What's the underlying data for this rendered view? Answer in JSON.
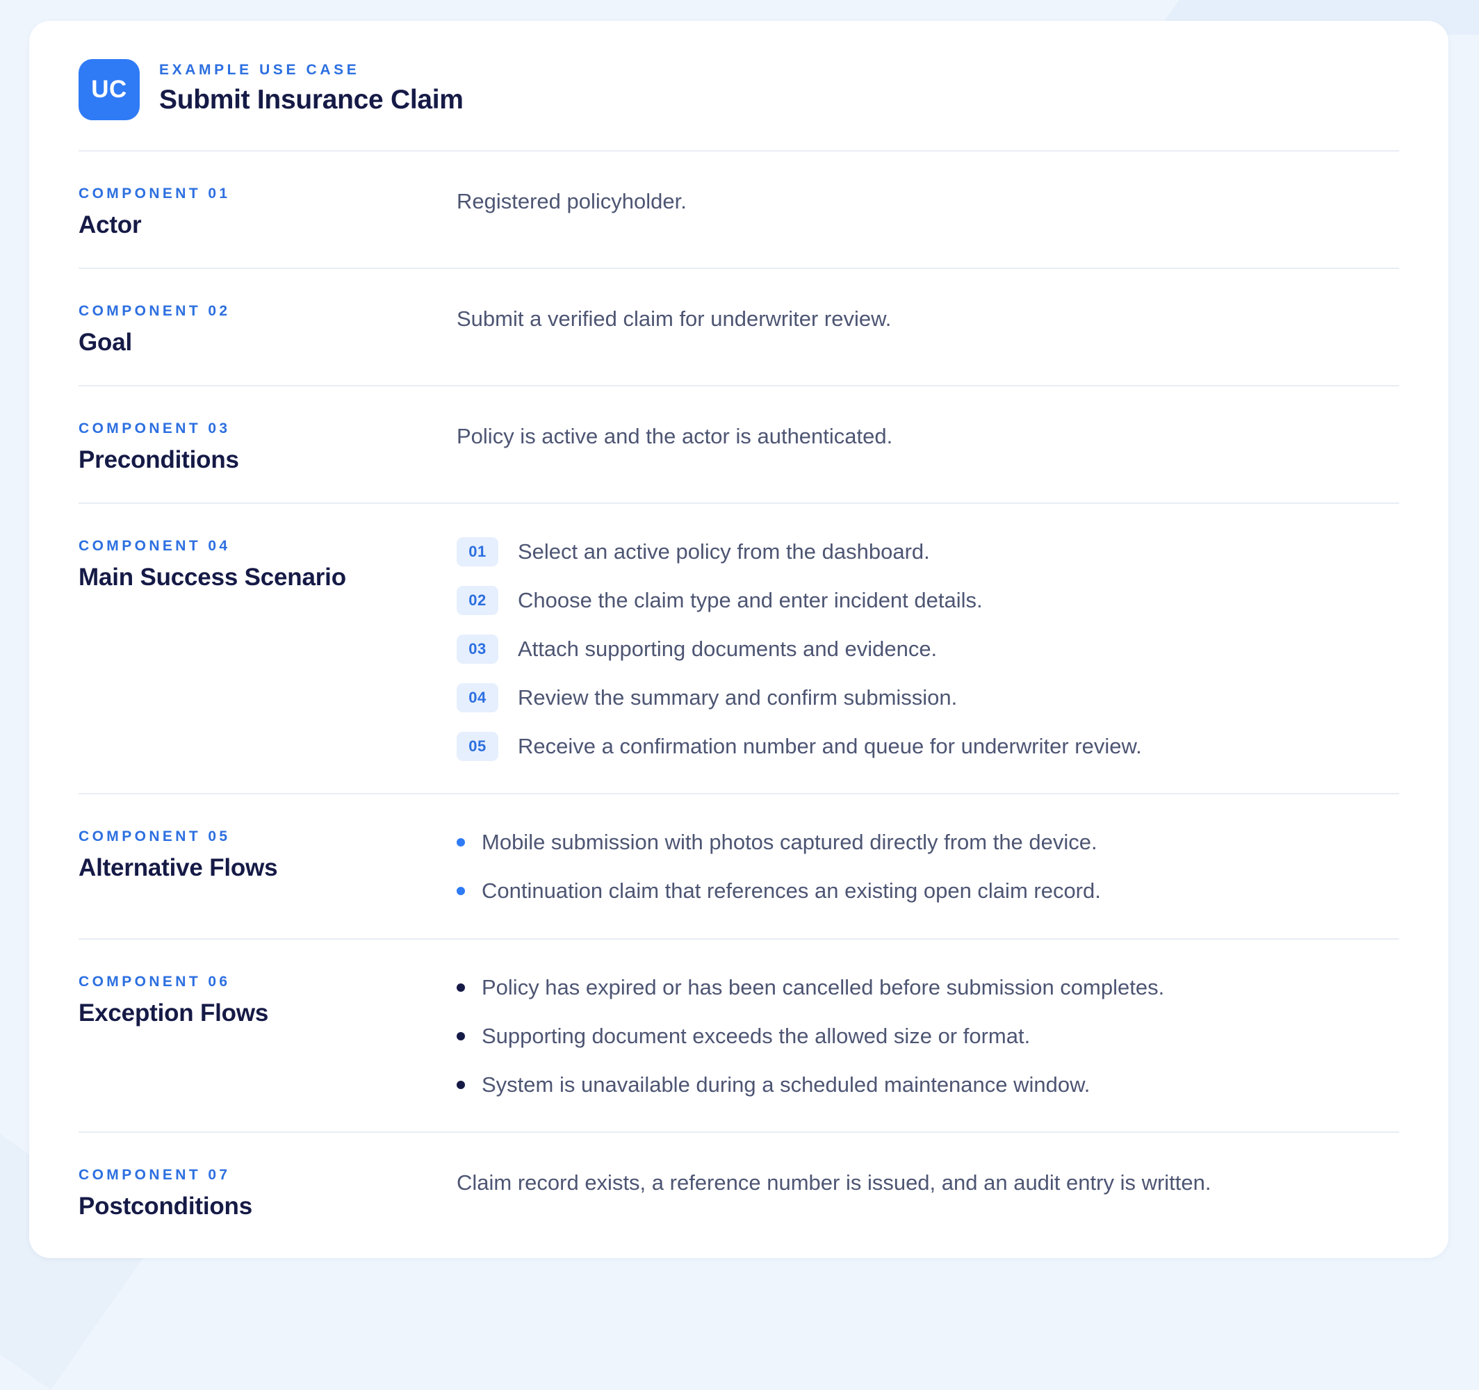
{
  "header": {
    "badge": "UC",
    "eyebrow": "EXAMPLE USE CASE",
    "title": "Submit Insurance Claim"
  },
  "components": [
    {
      "label": "COMPONENT 01",
      "name": "Actor",
      "text": "Registered policyholder."
    },
    {
      "label": "COMPONENT 02",
      "name": "Goal",
      "text": "Submit a verified claim for underwriter review."
    },
    {
      "label": "COMPONENT 03",
      "name": "Preconditions",
      "text": "Policy is active and the actor is authenticated."
    },
    {
      "label": "COMPONENT 04",
      "name": "Main Success Scenario",
      "steps": [
        {
          "num": "01",
          "text": "Select an active policy from the dashboard."
        },
        {
          "num": "02",
          "text": "Choose the claim type and enter incident details."
        },
        {
          "num": "03",
          "text": "Attach supporting documents and evidence."
        },
        {
          "num": "04",
          "text": "Review the summary and confirm submission."
        },
        {
          "num": "05",
          "text": "Receive a confirmation number and queue for underwriter review."
        }
      ]
    },
    {
      "label": "COMPONENT 05",
      "name": "Alternative Flows",
      "bullets": [
        "Mobile submission with photos captured directly from the device.",
        "Continuation claim that references an existing open claim record."
      ]
    },
    {
      "label": "COMPONENT 06",
      "name": "Exception Flows",
      "bullets": [
        "Policy has expired or has been cancelled before submission completes.",
        "Supporting document exceeds the allowed size or format.",
        "System is unavailable during a scheduled maintenance window."
      ]
    },
    {
      "label": "COMPONENT 07",
      "name": "Postconditions",
      "text": "Claim record exists, a reference number is issued, and an audit entry is written."
    }
  ],
  "colors": {
    "accent": "#2f7bf6",
    "label_blue": "#2c6fe0",
    "heading": "#151a46",
    "body_text": "#4d5573",
    "divider": "#e8edf5",
    "background": "#eef5fd"
  }
}
